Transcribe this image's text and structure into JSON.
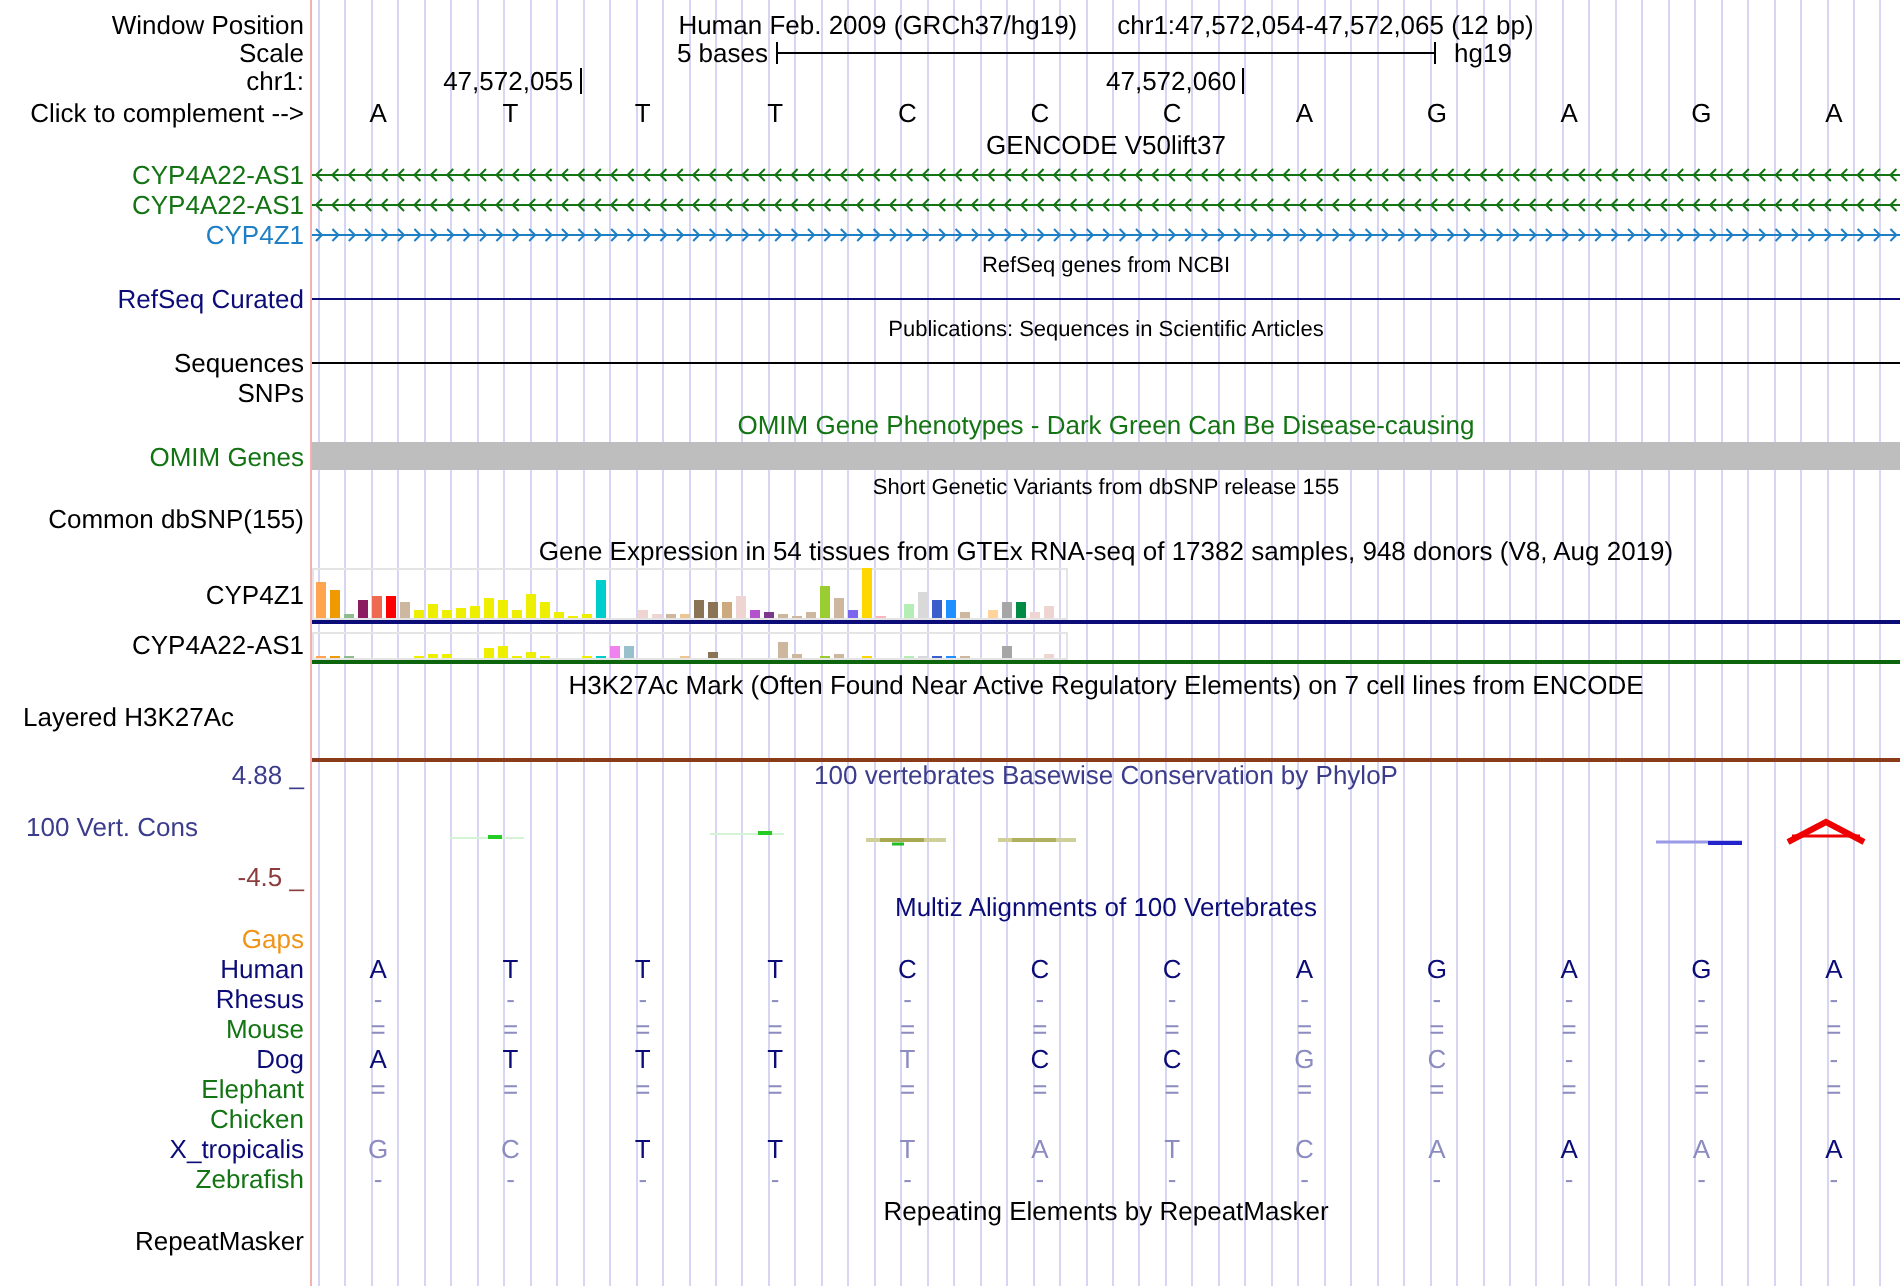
{
  "header": {
    "position": {
      "label": "Window Position",
      "assembly": "Human Feb. 2009 (GRCh37/hg19)",
      "range": "chr1:47,572,054-47,572,065 (12 bp)"
    },
    "scale": {
      "label": "Scale",
      "bar_label": "5 bases",
      "assembly": "hg19"
    },
    "ruler": {
      "label": "chr1:",
      "ticks": [
        {
          "label": "47,572,055"
        },
        {
          "label": "47,572,060"
        }
      ]
    },
    "sequence": {
      "label": "Click to complement -->",
      "bases": [
        "A",
        "T",
        "T",
        "T",
        "C",
        "C",
        "C",
        "A",
        "G",
        "A",
        "G",
        "A"
      ]
    }
  },
  "tracks": [
    {
      "kind": "gencode",
      "title": "GENCODE V50lift37",
      "color": "#000000",
      "rows": [
        {
          "kind": "gene",
          "label": "CYP4A22-AS1",
          "color": "#137413",
          "reverse": true
        },
        {
          "kind": "gene",
          "label": "CYP4A22-AS1",
          "color": "#137413",
          "reverse": true
        },
        {
          "kind": "gene",
          "label": "CYP4Z1",
          "color": "#1f7fc4",
          "reverse": false
        }
      ]
    },
    {
      "kind": "refseq",
      "title": "RefSeq genes from NCBI",
      "color": "#000000",
      "rows": [
        {
          "kind": "line",
          "label": "RefSeq Curated",
          "color": "#0c0c78"
        }
      ]
    },
    {
      "kind": "publications",
      "title": "Publications: Sequences in Scientific Articles",
      "color": "#000000",
      "rows": [
        {
          "kind": "line",
          "label": "Sequences",
          "color": "#000000"
        },
        {
          "kind": "empty",
          "label": "SNPs",
          "color": "#000000"
        }
      ]
    },
    {
      "kind": "omim",
      "title": "OMIM Gene Phenotypes - Dark Green Can Be Disease-causing",
      "color": "#137413",
      "rows": [
        {
          "kind": "bar",
          "label": "OMIM Genes",
          "color": "#137413"
        }
      ]
    },
    {
      "kind": "variants",
      "title": "Short Genetic Variants from dbSNP release 155",
      "color": "#000000",
      "rows": [
        {
          "kind": "empty",
          "label": "Common dbSNP(155)",
          "color": "#000000"
        }
      ]
    },
    {
      "kind": "expression",
      "title": "Gene Expression in 54 tissues from GTEx RNA-seq of 17382 samples, 948 donors (V8, Aug 2019)",
      "color": "#000000",
      "rows": [
        {
          "kind": "expression",
          "label": "CYP4Z1",
          "color": "#0c0c78"
        },
        {
          "kind": "expression",
          "label": "CYP4A22-AS1",
          "color": "#0c640c"
        }
      ]
    },
    {
      "kind": "chip",
      "title": "H3K27Ac Mark (Often Found Near Active Regulatory Elements) on 7 cell lines from ENCODE",
      "color": "#000000",
      "rows": [
        {
          "kind": "layered",
          "label": "Layered H3K27Ac",
          "color": "#000000"
        }
      ]
    },
    {
      "kind": "conservation",
      "title": "100 vertebrates Basewise Conservation by PhyloP",
      "color": "#3c3c8c",
      "rows": [
        {
          "kind": "wiggle",
          "label": "100 Vert. Cons",
          "color": "#3c3c8c",
          "upper": "4.88 _",
          "lower": "-4.5 _"
        }
      ]
    },
    {
      "kind": "multiz",
      "title": "Multiz Alignments of 100 Vertebrates",
      "color": "#0c0c78",
      "rows": [
        {
          "kind": "alignment",
          "label": "Gaps",
          "color": "#ef9418"
        },
        {
          "kind": "alignment",
          "label": "Human",
          "color": "#0c0c78",
          "bases": [
            {
              "text": "A",
              "match": true
            },
            {
              "text": "T",
              "match": true
            },
            {
              "text": "T",
              "match": true
            },
            {
              "text": "T",
              "match": true
            },
            {
              "text": "C",
              "match": true
            },
            {
              "text": "C",
              "match": true
            },
            {
              "text": "C",
              "match": true
            },
            {
              "text": "A",
              "match": true
            },
            {
              "text": "G",
              "match": true
            },
            {
              "text": "A",
              "match": true
            },
            {
              "text": "G",
              "match": true
            },
            {
              "text": "A",
              "match": true
            }
          ]
        },
        {
          "kind": "alignment",
          "label": "Rhesus",
          "color": "#0c0c78",
          "bases": [
            {
              "text": "-",
              "match": false
            },
            {
              "text": "-",
              "match": false
            },
            {
              "text": "-",
              "match": false
            },
            {
              "text": "-",
              "match": false
            },
            {
              "text": "-",
              "match": false
            },
            {
              "text": "-",
              "match": false
            },
            {
              "text": "-",
              "match": false
            },
            {
              "text": "-",
              "match": false
            },
            {
              "text": "-",
              "match": false
            },
            {
              "text": "-",
              "match": false
            },
            {
              "text": "-",
              "match": false
            },
            {
              "text": "-",
              "match": false
            }
          ]
        },
        {
          "kind": "alignment",
          "label": "Mouse",
          "color": "#137413",
          "bases": [
            {
              "text": "=",
              "match": false
            },
            {
              "text": "=",
              "match": false
            },
            {
              "text": "=",
              "match": false
            },
            {
              "text": "=",
              "match": false
            },
            {
              "text": "=",
              "match": false
            },
            {
              "text": "=",
              "match": false
            },
            {
              "text": "=",
              "match": false
            },
            {
              "text": "=",
              "match": false
            },
            {
              "text": "=",
              "match": false
            },
            {
              "text": "=",
              "match": false
            },
            {
              "text": "=",
              "match": false
            },
            {
              "text": "=",
              "match": false
            }
          ]
        },
        {
          "kind": "alignment",
          "label": "Dog",
          "color": "#0c0c78",
          "bases": [
            {
              "text": "A",
              "match": true
            },
            {
              "text": "T",
              "match": true
            },
            {
              "text": "T",
              "match": true
            },
            {
              "text": "T",
              "match": true
            },
            {
              "text": "T",
              "match": false
            },
            {
              "text": "C",
              "match": true
            },
            {
              "text": "C",
              "match": true
            },
            {
              "text": "G",
              "match": false
            },
            {
              "text": "C",
              "match": false
            },
            {
              "text": "-",
              "match": false
            },
            {
              "text": "-",
              "match": false
            },
            {
              "text": "-",
              "match": false
            }
          ]
        },
        {
          "kind": "alignment",
          "label": "Elephant",
          "color": "#137413",
          "bases": [
            {
              "text": "=",
              "match": false
            },
            {
              "text": "=",
              "match": false
            },
            {
              "text": "=",
              "match": false
            },
            {
              "text": "=",
              "match": false
            },
            {
              "text": "=",
              "match": false
            },
            {
              "text": "=",
              "match": false
            },
            {
              "text": "=",
              "match": false
            },
            {
              "text": "=",
              "match": false
            },
            {
              "text": "=",
              "match": false
            },
            {
              "text": "=",
              "match": false
            },
            {
              "text": "=",
              "match": false
            },
            {
              "text": "=",
              "match": false
            }
          ]
        },
        {
          "kind": "alignment",
          "label": "Chicken",
          "color": "#137413"
        },
        {
          "kind": "alignment",
          "label": "X_tropicalis",
          "color": "#0c0c78",
          "bases": [
            {
              "text": "G",
              "match": false
            },
            {
              "text": "C",
              "match": false
            },
            {
              "text": "T",
              "match": true
            },
            {
              "text": "T",
              "match": true
            },
            {
              "text": "T",
              "match": false
            },
            {
              "text": "A",
              "match": false
            },
            {
              "text": "T",
              "match": false
            },
            {
              "text": "C",
              "match": false
            },
            {
              "text": "A",
              "match": false
            },
            {
              "text": "A",
              "match": true
            },
            {
              "text": "A",
              "match": false
            },
            {
              "text": "A",
              "match": true
            }
          ]
        },
        {
          "kind": "alignment",
          "label": "Zebrafish",
          "color": "#137413",
          "bases": [
            {
              "text": "-",
              "match": false
            },
            {
              "text": "-",
              "match": false
            },
            {
              "text": "-",
              "match": false
            },
            {
              "text": "-",
              "match": false
            },
            {
              "text": "-",
              "match": false
            },
            {
              "text": "-",
              "match": false
            },
            {
              "text": "-",
              "match": false
            },
            {
              "text": "-",
              "match": false
            },
            {
              "text": "-",
              "match": false
            },
            {
              "text": "-",
              "match": false
            },
            {
              "text": "-",
              "match": false
            },
            {
              "text": "-",
              "match": false
            }
          ]
        }
      ]
    },
    {
      "kind": "repeats",
      "title": "Repeating Elements by RepeatMasker",
      "color": "#000000",
      "rows": [
        {
          "kind": "empty",
          "label": "RepeatMasker",
          "color": "#000000"
        }
      ]
    }
  ]
}
